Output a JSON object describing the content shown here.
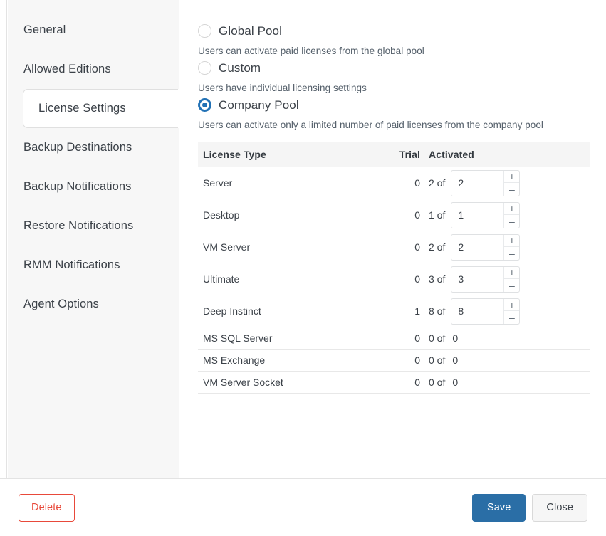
{
  "sidebar": {
    "items": [
      {
        "label": "General",
        "active": false
      },
      {
        "label": "Allowed Editions",
        "active": false
      },
      {
        "label": "License Settings",
        "active": true
      },
      {
        "label": "Backup Destinations",
        "active": false
      },
      {
        "label": "Backup Notifications",
        "active": false
      },
      {
        "label": "Restore Notifications",
        "active": false
      },
      {
        "label": "RMM Notifications",
        "active": false
      },
      {
        "label": "Agent Options",
        "active": false
      }
    ]
  },
  "license_settings": {
    "options": [
      {
        "id": "global-pool",
        "label": "Global Pool",
        "description": "Users can activate paid licenses from the global pool",
        "selected": false
      },
      {
        "id": "custom",
        "label": "Custom",
        "description": "Users have individual licensing settings",
        "selected": false
      },
      {
        "id": "company-pool",
        "label": "Company Pool",
        "description": "Users can activate only a limited number of paid licenses from the company pool",
        "selected": true
      }
    ],
    "table": {
      "columns": [
        "License Type",
        "Trial",
        "Activated"
      ],
      "rows": [
        {
          "type": "Server",
          "trial": "0",
          "of_text": "2 of",
          "limit": "2",
          "editable": true
        },
        {
          "type": "Desktop",
          "trial": "0",
          "of_text": "1 of",
          "limit": "1",
          "editable": true
        },
        {
          "type": "VM Server",
          "trial": "0",
          "of_text": "2 of",
          "limit": "2",
          "editable": true
        },
        {
          "type": "Ultimate",
          "trial": "0",
          "of_text": "3 of",
          "limit": "3",
          "editable": true
        },
        {
          "type": "Deep Instinct",
          "trial": "1",
          "of_text": "8 of",
          "limit": "8",
          "editable": true
        },
        {
          "type": "MS SQL Server",
          "trial": "0",
          "of_text": "0 of",
          "limit": "0",
          "editable": false
        },
        {
          "type": "MS Exchange",
          "trial": "0",
          "of_text": "0 of",
          "limit": "0",
          "editable": false
        },
        {
          "type": "VM Server Socket",
          "trial": "0",
          "of_text": "0 of",
          "limit": "0",
          "editable": false
        }
      ],
      "spinner_increment_label": "+",
      "spinner_decrement_label": "–"
    }
  },
  "footer": {
    "delete_label": "Delete",
    "save_label": "Save",
    "close_label": "Close"
  },
  "colors": {
    "accent_blue": "#2171b5",
    "save_blue": "#2a6ea6",
    "danger_red": "#e8493a",
    "sidebar_bg": "#f7f7f7",
    "table_header_bg": "#f5f5f5"
  }
}
